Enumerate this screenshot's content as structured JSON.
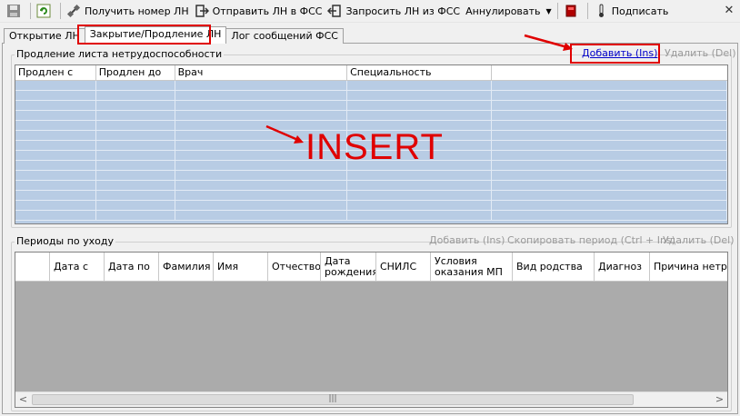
{
  "toolbar": {
    "get_number": "Получить номер ЛН",
    "send_fss": "Отправить ЛН в ФСС",
    "request_fss": "Запросить ЛН из ФСС",
    "annul": "Аннулировать",
    "sign": "Подписать",
    "close_glyph": "✕"
  },
  "tabs": [
    "Открытие ЛН",
    "Закрытие/Продление ЛН",
    "Лог сообщений ФСС"
  ],
  "prolong": {
    "title": "Продление листа нетрудоспособности",
    "add": "Добавить (Ins)",
    "delete": "Удалить (Del)",
    "columns": [
      "Продлен с",
      "Продлен до",
      "Врач",
      "Специальность",
      ""
    ]
  },
  "annotation": {
    "insert": "INSERT"
  },
  "care": {
    "title": "Периоды по уходу",
    "add": "Добавить (Ins)",
    "copy": "Скопировать период (Ctrl + Ins)",
    "delete": "Удалить (Del)",
    "columns": [
      "",
      "Дата с",
      "Дата по",
      "Фамилия",
      "Имя",
      "Отчество",
      "Дата рождения",
      "СНИЛС",
      "Условия оказания МП",
      "Вид родства",
      "Диагноз",
      "Причина нетрудоспособности"
    ]
  },
  "scroll": {
    "left": "<",
    "right": ">",
    "grip": "|||"
  },
  "colors": {
    "highlight": "#e00000",
    "grid_selected": "#b8cce4",
    "grid_empty": "#ababab",
    "link": "#0000cc"
  }
}
